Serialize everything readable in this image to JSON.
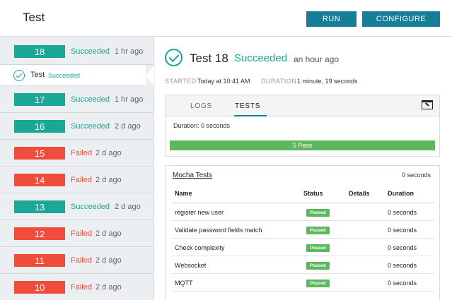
{
  "header": {
    "title": "Test",
    "run_label": "RUN",
    "configure_label": "CONFIGURE"
  },
  "sidebar": {
    "builds": [
      {
        "number": "18",
        "status": "Succeeded",
        "time": "1 hr ago",
        "state": "ok"
      },
      {
        "number": "17",
        "status": "Succeeded",
        "time": "1 hr ago",
        "state": "ok"
      },
      {
        "number": "16",
        "status": "Succeeded",
        "time": "2 d ago",
        "state": "ok"
      },
      {
        "number": "15",
        "status": "Failed",
        "time": "2 d ago",
        "state": "fail"
      },
      {
        "number": "14",
        "status": "Failed",
        "time": "2 d ago",
        "state": "fail"
      },
      {
        "number": "13",
        "status": "Succeeded",
        "time": "2 d ago",
        "state": "ok"
      },
      {
        "number": "12",
        "status": "Failed",
        "time": "2 d ago",
        "state": "fail"
      },
      {
        "number": "11",
        "status": "Failed",
        "time": "2 d ago",
        "state": "fail"
      },
      {
        "number": "10",
        "status": "Failed",
        "time": "2 d ago",
        "state": "fail"
      }
    ],
    "selected_sub": {
      "label": "Test",
      "status": "Succeeded"
    }
  },
  "main": {
    "title": "Test 18",
    "status": "Succeeded",
    "ago": "an hour ago",
    "started_label": "STARTED",
    "started_value": "Today at 10:41 AM",
    "duration_label": "DURATION",
    "duration_value": "1 minute, 19 seconds"
  },
  "panel": {
    "tabs": [
      "LOGS",
      "TESTS"
    ],
    "active_tab": "TESTS",
    "duration_line": "Duration: 0 seconds",
    "progress_label": "5 Pass",
    "progress_fraction": 1.0
  },
  "suite": {
    "name": "Mocha Tests",
    "duration": "0 seconds",
    "columns": [
      "Name",
      "Status",
      "Details",
      "Duration"
    ],
    "rows": [
      {
        "name": "register new user",
        "status": "Passed",
        "duration": "0 seconds"
      },
      {
        "name": "Validate password fields match",
        "status": "Passed",
        "duration": "0 seconds"
      },
      {
        "name": "Check complexity",
        "status": "Passed",
        "duration": "0 seconds"
      },
      {
        "name": "Websocket",
        "status": "Passed",
        "duration": "0 seconds"
      },
      {
        "name": "MQTT",
        "status": "Passed",
        "duration": "0 seconds"
      }
    ]
  },
  "colors": {
    "accent": "#167f97",
    "success": "#1aa795",
    "failure": "#f04c3b",
    "pass_badge": "#5cb85c"
  }
}
